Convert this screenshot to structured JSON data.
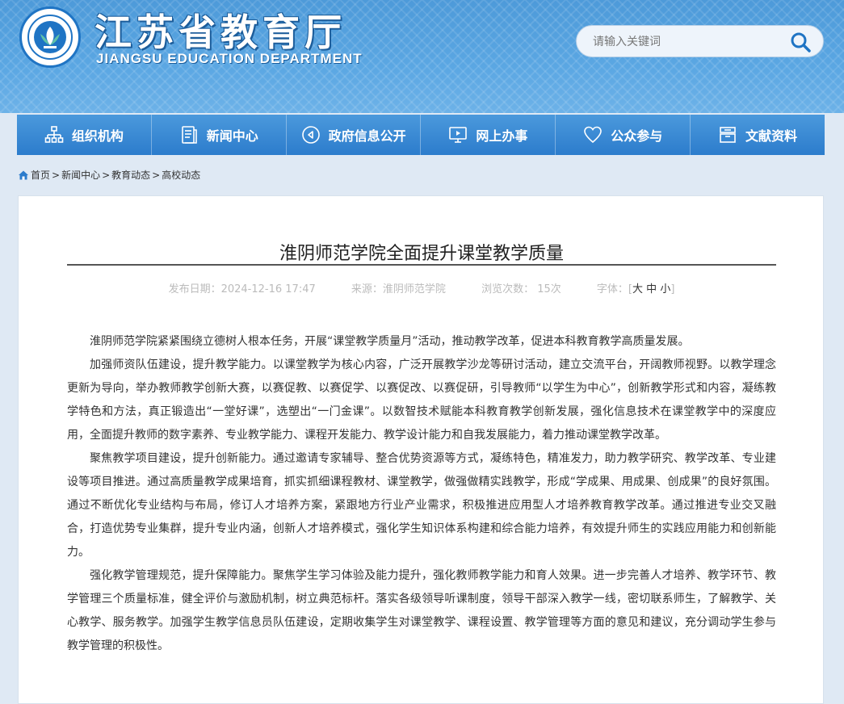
{
  "header": {
    "site_title": "江苏省教育厅",
    "site_subtitle": "JIANGSU EDUCATION DEPARTMENT",
    "search_placeholder": "请输入关键词"
  },
  "nav": {
    "items": [
      {
        "label": "组织机构",
        "icon": "org-chart-icon"
      },
      {
        "label": "新闻中心",
        "icon": "document-icon"
      },
      {
        "label": "政府信息公开",
        "icon": "speaker-icon"
      },
      {
        "label": "网上办事",
        "icon": "monitor-icon"
      },
      {
        "label": "公众参与",
        "icon": "heart-icon"
      },
      {
        "label": "文献资料",
        "icon": "archive-icon"
      }
    ]
  },
  "breadcrumb": {
    "home": "首页",
    "items": [
      "新闻中心",
      "教育动态",
      "高校动态"
    ],
    "separator": ">"
  },
  "article": {
    "title": "淮阴师范学院全面提升课堂教学质量",
    "publish_label": "发布日期：",
    "publish_date": "2024-12-16 17:47",
    "source_label": "来源：",
    "source": "淮阴师范学院",
    "views_label": "浏览次数：",
    "views": "15次",
    "font_size_label": "字体：",
    "font_sizes": [
      "大",
      "中",
      "小"
    ],
    "paragraphs": [
      "淮阴师范学院紧紧围绕立德树人根本任务，开展“课堂教学质量月”活动，推动教学改革，促进本科教育教学高质量发展。",
      "加强师资队伍建设，提升教学能力。以课堂教学为核心内容，广泛开展教学沙龙等研讨活动，建立交流平台，开阔教师视野。以教学理念更新为导向，举办教师教学创新大赛，以赛促教、以赛促学、以赛促改、以赛促研，引导教师“以学生为中心”，创新教学形式和内容，凝练教学特色和方法，真正锻造出“一堂好课”，选塑出“一门金课”。以数智技术赋能本科教育教学创新发展，强化信息技术在课堂教学中的深度应用，全面提升教师的数字素养、专业教学能力、课程开发能力、教学设计能力和自我发展能力，着力推动课堂教学改革。",
      "聚焦教学项目建设，提升创新能力。通过邀请专家辅导、整合优势资源等方式，凝练特色，精准发力，助力教学研究、教学改革、专业建设等项目推进。通过高质量教学成果培育，抓实抓细课程教材、课堂教学，做强做精实践教学，形成“学成果、用成果、创成果”的良好氛围。通过不断优化专业结构与布局，修订人才培养方案，紧跟地方行业产业需求，积极推进应用型人才培养教育教学改革。通过推进专业交叉融合，打造优势专业集群，提升专业内涵，创新人才培养模式，强化学生知识体系构建和综合能力培养，有效提升师生的实践应用能力和创新能力。",
      "强化教学管理规范，提升保障能力。聚焦学生学习体验及能力提升，强化教师教学能力和育人效果。进一步完善人才培养、教学环节、教学管理三个质量标准，健全评价与激励机制，树立典范标杆。落实各级领导听课制度，领导干部深入教学一线，密切联系师生，了解教学、关心教学、服务教学。加强学生教学信息员队伍建设，定期收集学生对课堂教学、课程设置、教学管理等方面的意见和建议，充分调动学生参与教学管理的积极性。"
    ]
  }
}
